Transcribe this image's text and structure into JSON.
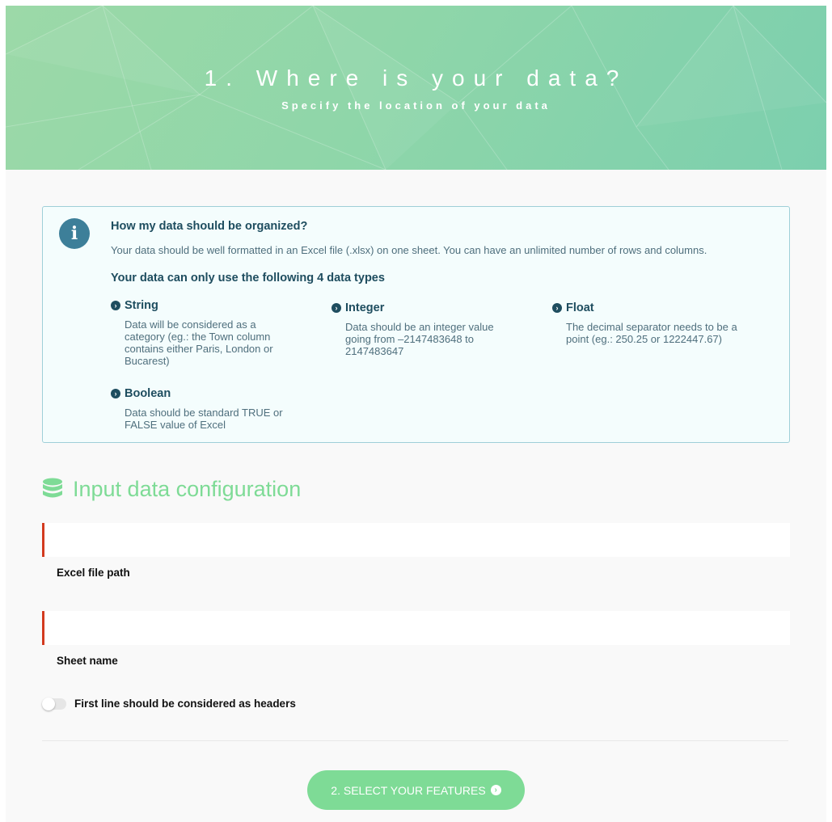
{
  "header": {
    "title": "1. Where is your data?",
    "subtitle": "Specify the location of your data"
  },
  "info": {
    "icon": "info-icon",
    "heading": "How my data should be organized?",
    "text": "Your data should be well formatted in an Excel file (.xlsx) on one sheet. You can have an unlimited number of rows and columns.",
    "types_heading": "Your data can only use the following 4 data types",
    "types": [
      {
        "name": "String",
        "description": "Data will be considered as a category (eg.: the Town column contains either Paris, London or Bucarest)"
      },
      {
        "name": "Integer",
        "description": "Data should be an integer value going from –2147483648 to 2147483647"
      },
      {
        "name": "Float",
        "description": "The decimal separator needs to be a point (eg.: 250.25 or 1222447.67)"
      },
      {
        "name": "Boolean",
        "description": "Data should be standard TRUE or FALSE value of Excel"
      }
    ]
  },
  "section": {
    "icon": "database-icon",
    "title": "Input data configuration"
  },
  "form": {
    "excel_path": {
      "label": "Excel file path",
      "value": "",
      "placeholder": ""
    },
    "sheet_name": {
      "label": "Sheet name",
      "value": "",
      "placeholder": ""
    },
    "headers_toggle": {
      "label": "First line should be considered as headers",
      "checked": false
    }
  },
  "next_button": {
    "label": "2. SELECT YOUR FEATURES",
    "icon": "arrow-circle-right-icon"
  },
  "colors": {
    "accent": "#7edb96",
    "info_dark": "#1e4d5f",
    "required_bar": "#d33a1f",
    "hero_start": "#9cd9a8",
    "hero_end": "#7ccfae"
  }
}
